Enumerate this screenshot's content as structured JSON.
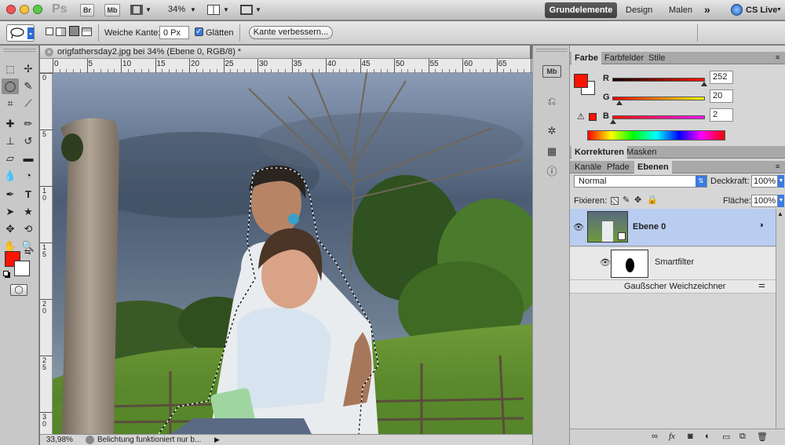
{
  "app": {
    "logo": "Ps",
    "bridge_btn": "Br",
    "minibridge_btn": "Mb",
    "zoom_value": "34%",
    "workspaces": {
      "active": "Grundelemente",
      "design": "Design",
      "paint": "Malen",
      "more": "»"
    },
    "cs_live": "CS Live"
  },
  "options": {
    "feather_label": "Weiche Kante:",
    "feather_value": "0 Px",
    "antialias_label": "Glätten",
    "antialias_checked": true,
    "refine_edge": "Kante verbessern..."
  },
  "document": {
    "tab_title": "origfathersday2.jpg bei 34% (Ebene 0, RGB/8) *",
    "ruler_h": [
      "0",
      "5",
      "10",
      "15",
      "20",
      "25",
      "30",
      "35",
      "40",
      "45",
      "50",
      "55",
      "60",
      "65",
      "70"
    ],
    "ruler_v": [
      "0",
      "5",
      "1 0",
      "1 5",
      "2 0",
      "2 5",
      "3 0"
    ],
    "status_zoom": "33,98%",
    "status_info": "Belichtung funktioniert nur b..."
  },
  "color_panel": {
    "tabs": [
      "Farbe",
      "Farbfelder",
      "Stile"
    ],
    "active_tab": "Farbe",
    "fg_color": "#fc1402",
    "channels": [
      {
        "label": "R",
        "value": "252",
        "fraction": 0.99
      },
      {
        "label": "G",
        "value": "20",
        "fraction": 0.08
      },
      {
        "label": "B",
        "value": "2",
        "fraction": 0.01
      }
    ]
  },
  "adjust_tabs": [
    "Korrekturen",
    "Masken"
  ],
  "layers_panel": {
    "tabs": [
      "Kanäle",
      "Pfade",
      "Ebenen"
    ],
    "active_tab": "Ebenen",
    "blend_mode": "Normal",
    "opacity_label": "Deckkraft:",
    "opacity_value": "100%",
    "lock_label": "Fixieren:",
    "fill_label": "Fläche:",
    "fill_value": "100%",
    "layer_name": "Ebene 0",
    "smart_filter": "Smartfilter",
    "filter_name": "Gaußscher Weichzeichner"
  },
  "colors": {
    "accent": "#b9cdf0",
    "fg_swatch": "#fc1402"
  }
}
